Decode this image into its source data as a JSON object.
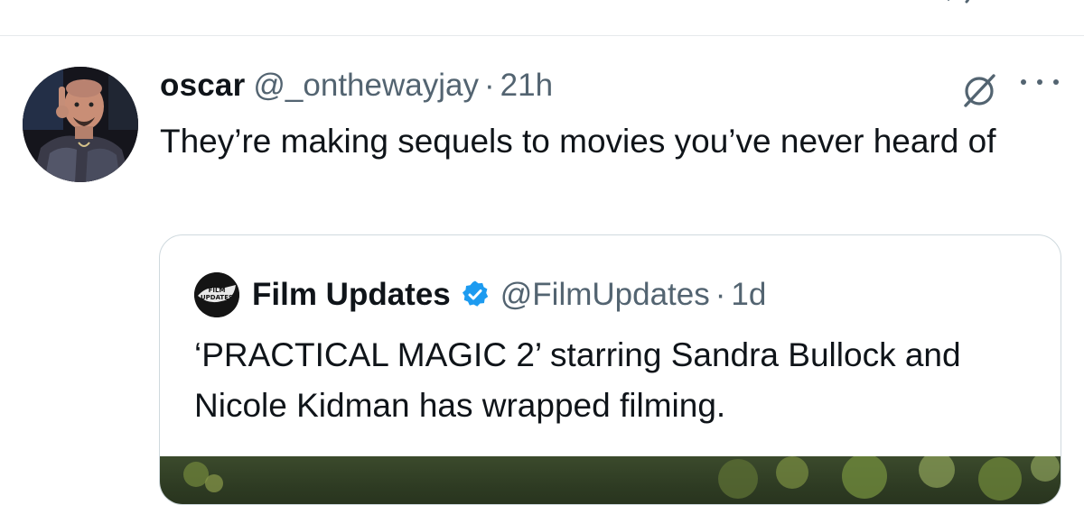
{
  "colors": {
    "text_primary": "#0f1419",
    "text_secondary": "#536471",
    "divider": "#e6e9ec",
    "quote_border": "#cfd9de",
    "verified": "#1d9bf0"
  },
  "tweet": {
    "display_name": "oscar",
    "handle": "@_onthewayjay",
    "separator": "·",
    "time": "21h",
    "text": "They’re making sequels to movies you’ve never heard of",
    "icons": [
      "grok-icon",
      "more-icon"
    ]
  },
  "quote": {
    "avatar_text": "FILM UPDATES",
    "display_name": "Film Updates",
    "verified": true,
    "handle": "@FilmUpdates",
    "separator": "·",
    "time": "1d",
    "text": "‘PRACTICAL MAGIC 2’ starring Sandra Bullock and Nicole Kidman has wrapped filming."
  }
}
